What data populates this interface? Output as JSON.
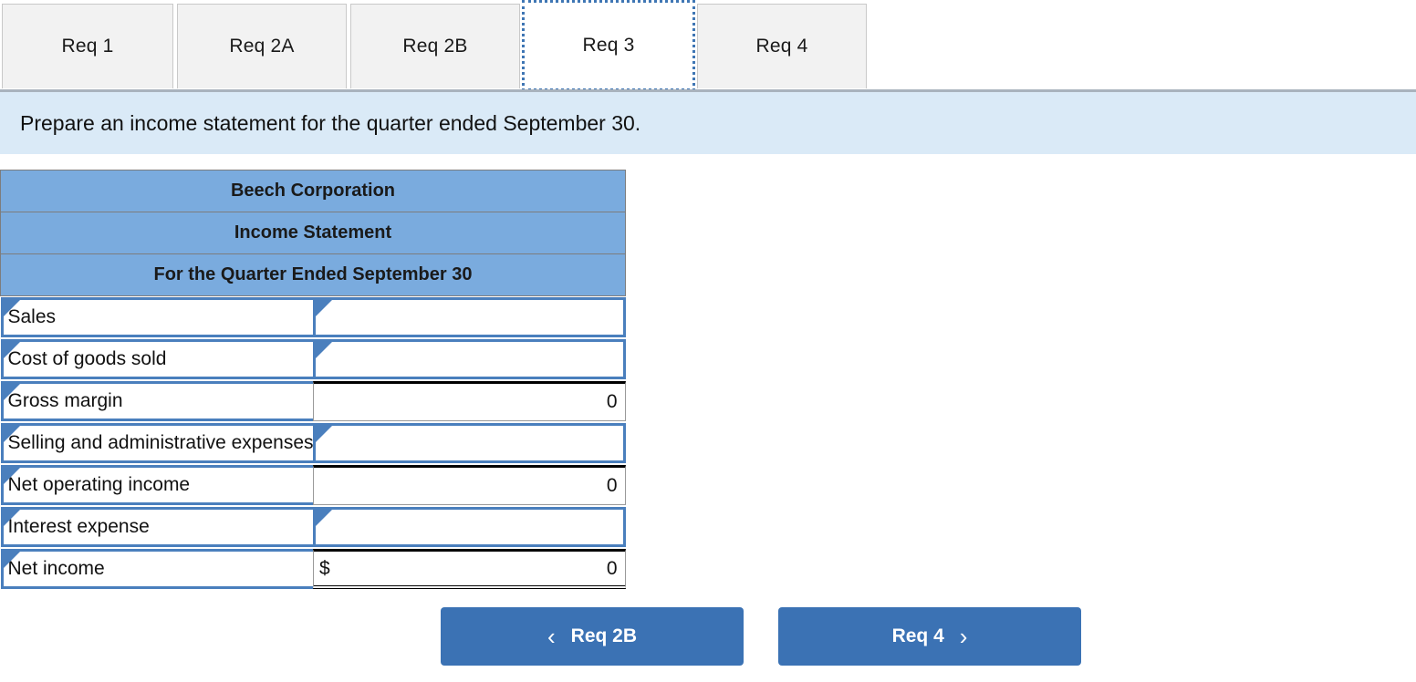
{
  "tabs": {
    "items": [
      {
        "id": "req1",
        "label": "Req 1",
        "active": false
      },
      {
        "id": "req2a",
        "label": "Req 2A",
        "active": false
      },
      {
        "id": "req2b",
        "label": "Req 2B",
        "active": false
      },
      {
        "id": "req3",
        "label": "Req 3",
        "active": true
      },
      {
        "id": "req4",
        "label": "Req 4",
        "active": false
      }
    ]
  },
  "instruction": {
    "text": "Prepare an income statement for the quarter ended September 30."
  },
  "statement": {
    "header_lines": [
      "Beech Corporation",
      "Income Statement",
      "For the Quarter Ended September 30"
    ],
    "rows": [
      {
        "label": "Sales",
        "kind": "input",
        "currency": "",
        "value": ""
      },
      {
        "label": "Cost of goods sold",
        "kind": "input",
        "currency": "",
        "value": ""
      },
      {
        "label": "Gross margin",
        "kind": "computed",
        "currency": "",
        "value": "0"
      },
      {
        "label": "Selling and administrative expenses",
        "kind": "input",
        "currency": "",
        "value": ""
      },
      {
        "label": "Net operating income",
        "kind": "computed",
        "currency": "",
        "value": "0"
      },
      {
        "label": "Interest expense",
        "kind": "input",
        "currency": "",
        "value": ""
      },
      {
        "label": "Net income",
        "kind": "computed",
        "currency": "$",
        "value": "0",
        "final": true
      }
    ]
  },
  "navigation": {
    "prev_label": "Req 2B",
    "prev_icon": "chevron-left-icon",
    "prev_glyph": "‹",
    "next_label": "Req 4",
    "next_icon": "chevron-right-icon",
    "next_glyph": "›"
  },
  "colors": {
    "header_blue": "#7aabde",
    "banner_blue": "#daeaf7",
    "button_blue": "#3b72b4",
    "field_border_blue": "#4a7fbd",
    "tab_inactive": "#f2f2f2"
  }
}
